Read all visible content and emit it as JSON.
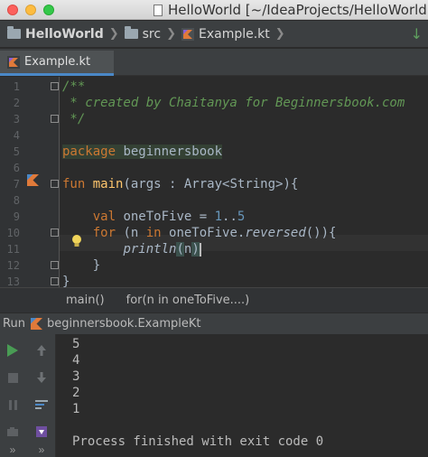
{
  "window": {
    "title": "HelloWorld [~/IdeaProjects/HelloWorld]"
  },
  "navbar": {
    "project": "HelloWorld",
    "folder": "src",
    "file": "Example.kt"
  },
  "tabs": [
    {
      "label": "Example.kt",
      "active": true
    }
  ],
  "editor": {
    "line_numbers": [
      "1",
      "2",
      "3",
      "4",
      "5",
      "6",
      "7",
      "8",
      "9",
      "10",
      "11",
      "12",
      "13"
    ],
    "caret_line": 11
  },
  "breadcrumb": {
    "items": [
      "main()",
      "for(n in oneToFive....)"
    ]
  },
  "run": {
    "label": "Run",
    "config": "beginnersbook.ExampleKt",
    "output": [
      "5",
      "4",
      "3",
      "2",
      "1",
      "",
      "Process finished with exit code 0"
    ]
  },
  "colors": {
    "editor_bg": "#2b2b2b",
    "keyword": "#cc7832",
    "comment": "#629755",
    "function": "#ffc66d",
    "number": "#6897bb",
    "run_green": "#499c54",
    "tab_accent": "#4a88c7"
  }
}
